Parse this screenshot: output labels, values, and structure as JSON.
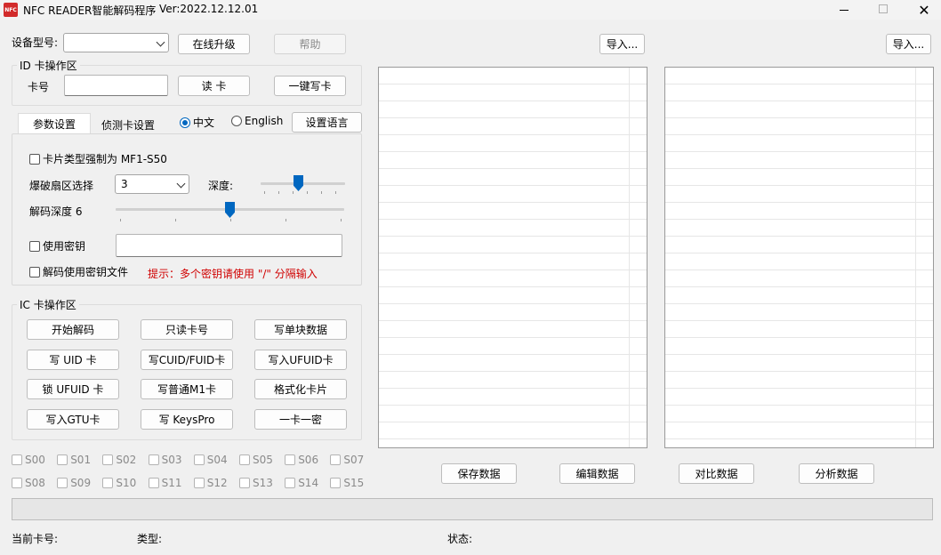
{
  "window": {
    "title": "NFC READER智能解码程序",
    "version": "Ver:2022.12.12.01",
    "icon_text": "NFC",
    "minimize_icon": "minimize-icon",
    "maximize_icon": "maximize-icon",
    "close_icon": "close-icon"
  },
  "toolbar": {
    "device_label": "设备型号:",
    "device_value": "",
    "upgrade_label": "在线升级",
    "help_label": "帮助"
  },
  "id_card": {
    "group_title": "ID 卡操作区",
    "card_label": "卡号",
    "card_value": "",
    "read_label": "读  卡",
    "write_label": "一键写卡"
  },
  "tabs": [
    {
      "label": "参数设置",
      "active": true
    },
    {
      "label": "侦测卡设置",
      "active": false
    }
  ],
  "language": {
    "options": [
      "中文",
      "English"
    ],
    "selected": "中文",
    "set_label": "设置语言"
  },
  "params": {
    "force_mf1_label": "卡片类型强制为 MF1-S50",
    "sector_label": "爆破扇区选择",
    "sector_value": "3",
    "depth_label": "深度:",
    "decode_depth_label": "解码深度 6",
    "use_key_label": "使用密钥",
    "key_value": "",
    "use_keyfile_label": "解码使用密钥文件",
    "hint": "提示：多个密钥请使用 \"/\" 分隔输入",
    "hint_color": "#d00000",
    "depth_slider_fraction": 0.4,
    "decode_depth_fraction": 0.5
  },
  "ic_card": {
    "group_title": "IC 卡操作区",
    "buttons": [
      "开始解码",
      "只读卡号",
      "写单块数据",
      "写 UID 卡",
      "写CUID/FUID卡",
      "写入UFUID卡",
      "锁 UFUID 卡",
      "写普通M1卡",
      "格式化卡片",
      "写入GTU卡",
      "写 KeysPro",
      "一卡一密"
    ]
  },
  "sectors": [
    "S00",
    "S01",
    "S02",
    "S03",
    "S04",
    "S05",
    "S06",
    "S07",
    "S08",
    "S09",
    "S10",
    "S11",
    "S12",
    "S13",
    "S14",
    "S15"
  ],
  "right": {
    "import_left": "导入...",
    "import_right": "导入...",
    "save_label": "保存数据",
    "edit_label": "编辑数据",
    "compare_label": "对比数据",
    "analyze_label": "分析数据"
  },
  "status": {
    "current_card_label": "当前卡号:",
    "type_label": "类型:",
    "state_label": "状态:"
  },
  "colors": {
    "accent": "#0067c0",
    "icon_red": "#d22b2b"
  }
}
